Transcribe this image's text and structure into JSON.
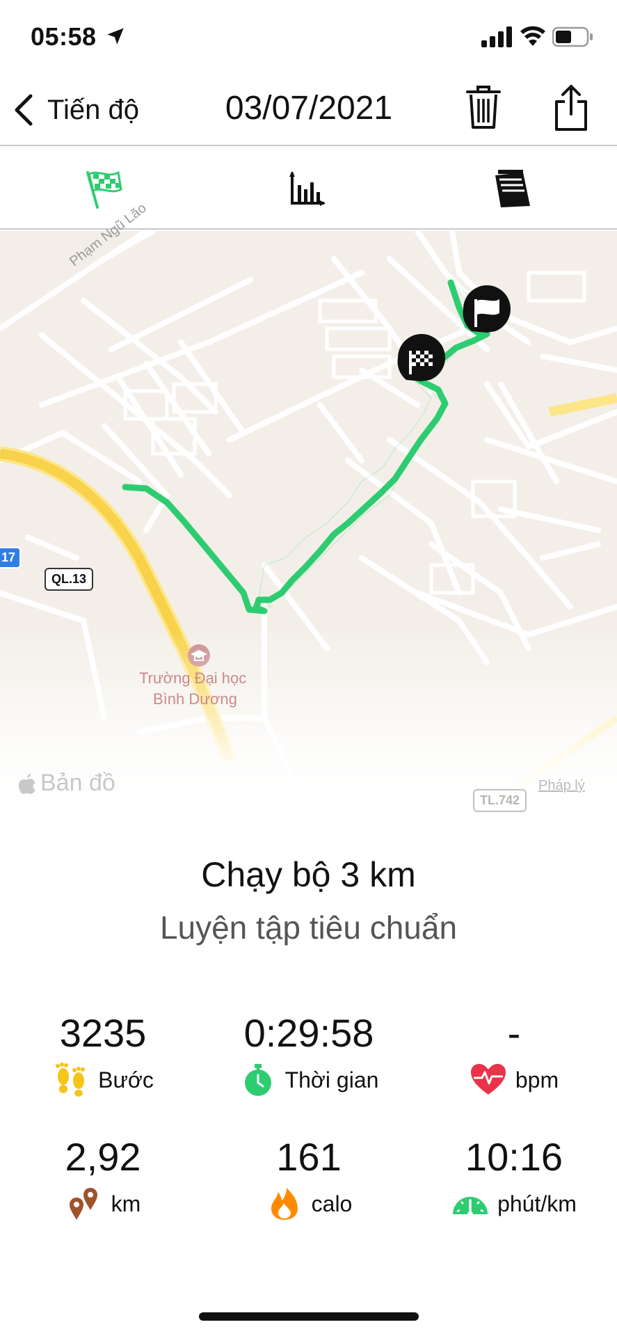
{
  "status_bar": {
    "time": "05:58"
  },
  "nav": {
    "back_label": "Tiến độ",
    "title": "03/07/2021"
  },
  "tabs": [
    {
      "name": "route",
      "icon": "checkered-flag-icon",
      "active": true
    },
    {
      "name": "charts",
      "icon": "bar-chart-icon",
      "active": false
    },
    {
      "name": "notes",
      "icon": "notepad-icon",
      "active": false
    }
  ],
  "map": {
    "street_label": "Phạm Ngũ Lão",
    "school_label_line1": "Trường Đại học",
    "school_label_line2": "Bình Dương",
    "highway_badge": "QL.13",
    "highway_badge_blue": "17",
    "road_badge_bottom": "TL.742",
    "attribution": "Bản đồ",
    "legal": "Pháp lý",
    "route_color": "#2ecc71"
  },
  "workout": {
    "title": "Chạy bộ 3 km",
    "subtitle": "Luyện tập tiêu chuẩn"
  },
  "stats": [
    {
      "value": "3235",
      "label": "Bước",
      "icon": "footsteps-icon"
    },
    {
      "value": "0:29:58",
      "label": "Thời gian",
      "icon": "stopwatch-icon"
    },
    {
      "value": "-",
      "label": "bpm",
      "icon": "heart-rate-icon"
    },
    {
      "value": "2,92",
      "label": "km",
      "icon": "distance-pins-icon"
    },
    {
      "value": "161",
      "label": "calo",
      "icon": "flame-icon"
    },
    {
      "value": "10:16",
      "label": "phút/km",
      "icon": "speedometer-icon"
    }
  ],
  "colors": {
    "accent_green": "#2ecc71",
    "steps_yellow": "#f5c518",
    "heart_red": "#e8334a",
    "distance_brown": "#a0522d",
    "flame_orange": "#ff8a00"
  }
}
